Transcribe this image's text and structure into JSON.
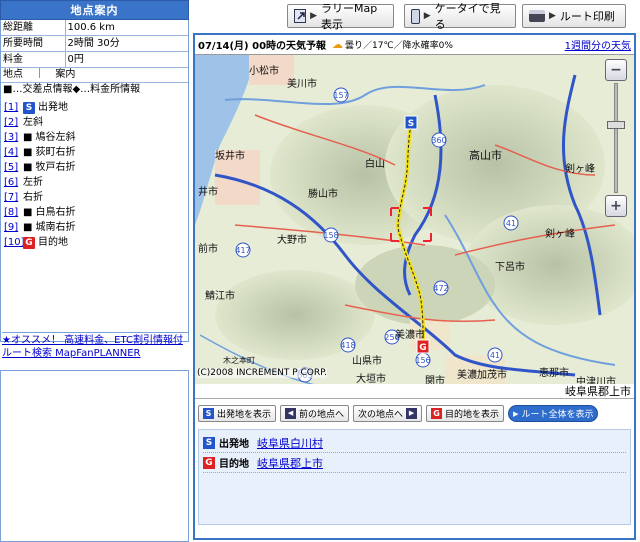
{
  "left_panel": {
    "header": "地点案内",
    "stats": [
      {
        "key": "総距離",
        "value": "100.6 km"
      },
      {
        "key": "所要時間",
        "value": "2時間 30分"
      },
      {
        "key": "料金",
        "value": "0円"
      }
    ],
    "list_head_a": "地点",
    "list_head_sep": "｜",
    "list_head_b": "案内",
    "legend": "■…交差点情報◆…料金所情報",
    "points": [
      {
        "num": "[1]",
        "badge": "S",
        "marker": "",
        "label": "出発地"
      },
      {
        "num": "[2]",
        "badge": "",
        "marker": "",
        "label": "左斜"
      },
      {
        "num": "[3]",
        "badge": "",
        "marker": "■",
        "label": "鳩谷左斜"
      },
      {
        "num": "[4]",
        "badge": "",
        "marker": "■",
        "label": "荻町右折"
      },
      {
        "num": "[5]",
        "badge": "",
        "marker": "■",
        "label": "牧戸右折"
      },
      {
        "num": "[6]",
        "badge": "",
        "marker": "",
        "label": "左折"
      },
      {
        "num": "[7]",
        "badge": "",
        "marker": "",
        "label": "右折"
      },
      {
        "num": "[8]",
        "badge": "",
        "marker": "■",
        "label": "白鳥右折"
      },
      {
        "num": "[9]",
        "badge": "",
        "marker": "■",
        "label": "城南右折"
      },
      {
        "num": "[10]",
        "badge": "G",
        "marker": "",
        "label": "目的地"
      }
    ],
    "promo": "★オススメ！ 高速料金、ETC割引情報付 ルート検索 MapFanPLANNER"
  },
  "top_buttons": {
    "rally": "ラリーMap表示",
    "mobile": "ケータイで見る",
    "print": "ルート印刷"
  },
  "weather": {
    "title": "07/14(月) 00時の天気予報",
    "condition": "曇り／17℃／降水確率0%",
    "week_link": "1週間分の天気"
  },
  "map": {
    "copyright": "(C)2008 INCREMENT P CORP.",
    "address": "岐阜県郡上市",
    "labels": [
      {
        "text": "小松市",
        "cls": ""
      },
      {
        "text": "美川市",
        "cls": ""
      },
      {
        "text": "坂井市",
        "cls": ""
      },
      {
        "text": "勝山市",
        "cls": ""
      },
      {
        "text": "大野市",
        "cls": ""
      },
      {
        "text": "白山",
        "cls": ""
      },
      {
        "text": "高山市",
        "cls": "big"
      },
      {
        "text": "剣ヶ峰",
        "cls": ""
      },
      {
        "text": "剣ヶ峰",
        "cls": ""
      },
      {
        "text": "下呂市",
        "cls": ""
      },
      {
        "text": "美濃市",
        "cls": ""
      },
      {
        "text": "山県市",
        "cls": ""
      },
      {
        "text": "関市",
        "cls": ""
      },
      {
        "text": "美濃加茂市",
        "cls": ""
      },
      {
        "text": "恵那市",
        "cls": ""
      },
      {
        "text": "中津川市",
        "cls": ""
      },
      {
        "text": "木之本町",
        "cls": ""
      },
      {
        "text": "井市",
        "cls": ""
      },
      {
        "text": "前市",
        "cls": ""
      },
      {
        "text": "鯖江市",
        "cls": ""
      },
      {
        "text": "大垣市",
        "cls": ""
      }
    ]
  },
  "nav_buttons": {
    "start": "出発地を表示",
    "prev": "前の地点へ",
    "next": "次の地点へ",
    "goal": "目的地を表示",
    "all": "ルート全体を表示"
  },
  "route": {
    "start_label": "出発地",
    "start_value": "岐阜県白川村",
    "goal_label": "目的地",
    "goal_value": "岐阜県郡上市"
  },
  "colors": {
    "accent": "#3a74c8",
    "start_badge": "#2255cc",
    "goal_badge": "#dd2222",
    "route": "#f0e020"
  }
}
